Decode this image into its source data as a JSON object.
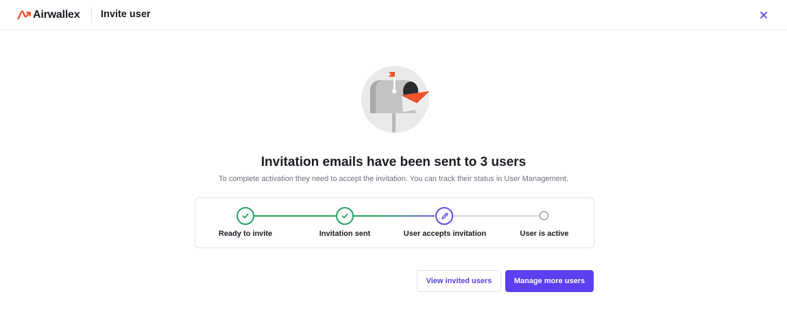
{
  "header": {
    "brand_name": "Airwallex",
    "page_title": "Invite user",
    "brand_color": "#f2542d",
    "close_icon": "close-icon"
  },
  "illustration": {
    "icon": "mailbox-illustration"
  },
  "main": {
    "headline": "Invitation emails have been sent to 3 users",
    "subtext": "To complete activation they need to accept the invitation. You can track their status in User Management."
  },
  "stepper": {
    "steps": [
      {
        "label": "Ready to invite",
        "status": "complete",
        "icon": "check-icon"
      },
      {
        "label": "Invitation sent",
        "status": "complete",
        "icon": "check-icon"
      },
      {
        "label": "User accepts invitation",
        "status": "current",
        "icon": "pencil-icon"
      },
      {
        "label": "User is active",
        "status": "pending",
        "icon": "circle-icon"
      }
    ],
    "colors": {
      "complete": "#21a35b",
      "current": "#5b4bf0",
      "pending": "#6b6f80"
    }
  },
  "actions": {
    "view_invited_label": "View invited users",
    "manage_more_label": "Manage more users",
    "primary_color": "#5b3ff0"
  }
}
